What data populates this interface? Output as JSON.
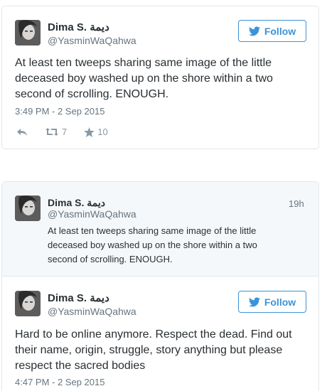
{
  "tweet1": {
    "name": "Dima S. ديمة",
    "handle": "@YasminWaQahwa",
    "follow_label": "Follow",
    "text": "At least ten tweeps sharing same image of the little deceased boy washed up on the shore within a two second of scrolling. ENOUGH.",
    "timestamp": "3:49 PM - 2 Sep 2015",
    "retweets": "7",
    "likes": "10",
    "icons": [
      "reply-icon",
      "retweet-icon",
      "star-icon"
    ]
  },
  "quoted": {
    "name": "Dima S. ديمة",
    "handle": "@YasminWaQahwa",
    "relative_time": "19h",
    "text": "At least ten tweeps sharing same image of the little deceased boy washed up on the shore within a two second of scrolling. ENOUGH."
  },
  "tweet2": {
    "name": "Dima S. ديمة",
    "handle": "@YasminWaQahwa",
    "follow_label": "Follow",
    "text": "Hard to be online anymore. Respect the dead. Find out their name, origin, struggle, story anything but please respect the sacred bodies",
    "timestamp": "4:47 PM - 2 Sep 2015"
  },
  "colors": {
    "twitter_blue": "#3b94d9",
    "muted_gray": "#66757f",
    "quoted_bg": "#f5f8fa",
    "border": "#e1e8ed"
  }
}
